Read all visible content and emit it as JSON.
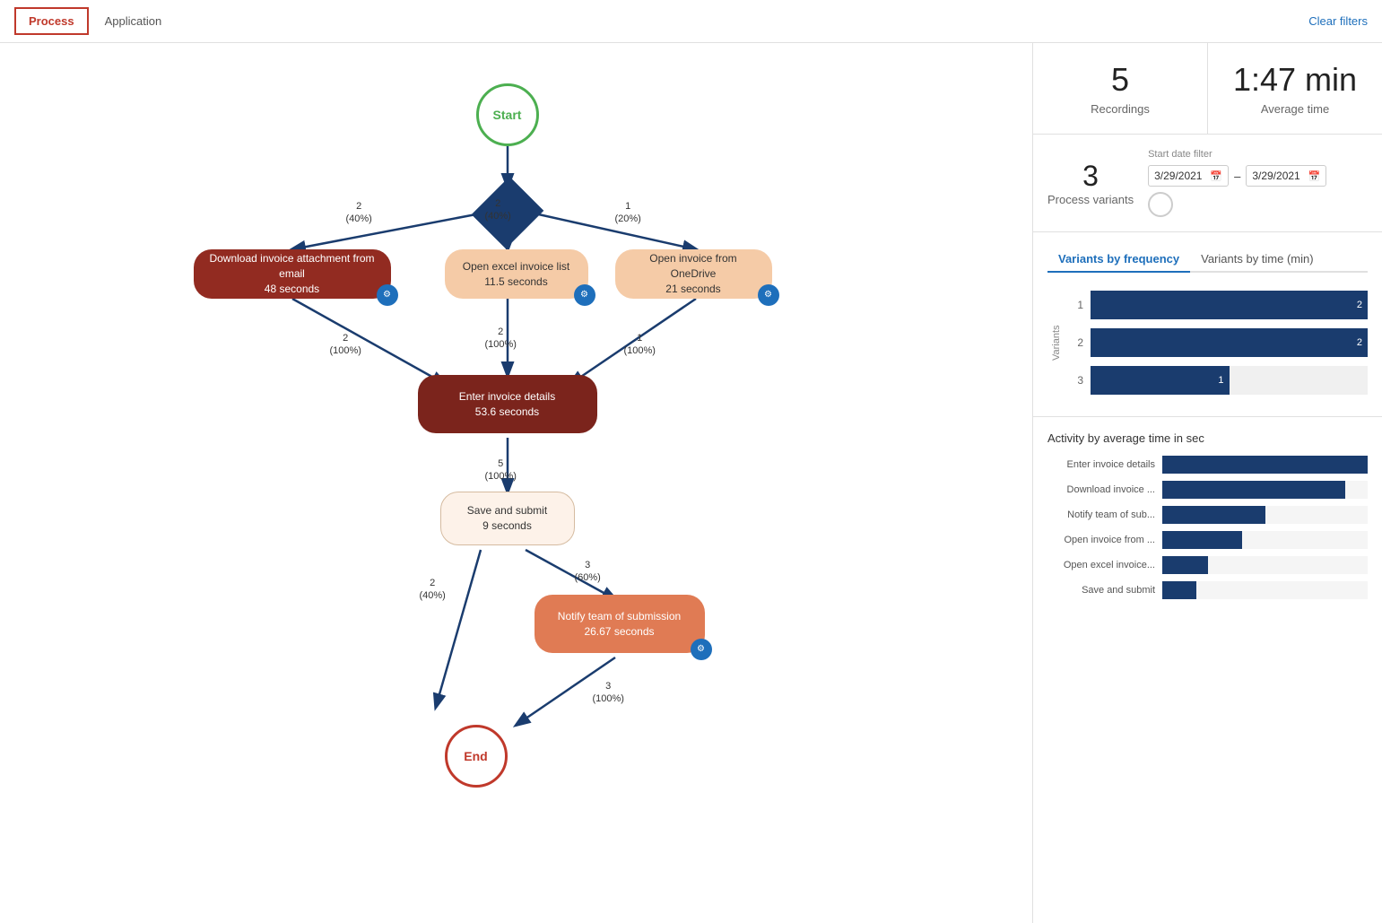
{
  "tabs": {
    "items": [
      "Process",
      "Application"
    ],
    "active": "Process"
  },
  "clear_filters": "Clear filters",
  "stats": {
    "recordings": {
      "value": "5",
      "label": "Recordings"
    },
    "average_time": {
      "value": "1:47 min",
      "label": "Average time"
    }
  },
  "process_variants": {
    "value": "3",
    "label": "Process variants"
  },
  "date_filter": {
    "label": "Start date filter",
    "from": "3/29/2021",
    "to": "3/29/2021"
  },
  "variants_chart": {
    "tab1": "Variants by frequency",
    "tab2": "Variants by time (min)",
    "active_tab": "tab1",
    "y_axis_label": "Variants",
    "bars": [
      {
        "label": "1",
        "value": 2,
        "max": 2
      },
      {
        "label": "2",
        "value": 2,
        "max": 2
      },
      {
        "label": "3",
        "value": 1,
        "max": 2
      }
    ]
  },
  "activity_chart": {
    "title": "Activity by average time in sec",
    "bars": [
      {
        "label": "Enter invoice details",
        "value": 54,
        "display": "54",
        "max": 54
      },
      {
        "label": "Download invoice ...",
        "value": 48,
        "display": "48",
        "max": 54
      },
      {
        "label": "Notify team of sub...",
        "value": 27,
        "display": "27",
        "max": 54
      },
      {
        "label": "Open invoice from ...",
        "value": 21,
        "display": "21",
        "max": 54
      },
      {
        "label": "Open excel invoice...",
        "value": 12,
        "display": "12",
        "max": 54
      },
      {
        "label": "Save and submit",
        "value": 9,
        "display": "9",
        "max": 54
      }
    ]
  },
  "flow": {
    "start_label": "Start",
    "end_label": "End",
    "nodes": [
      {
        "id": "start",
        "label": "Start",
        "type": "start"
      },
      {
        "id": "download",
        "label": "Download invoice attachment from email\n48 seconds",
        "type": "red"
      },
      {
        "id": "excel",
        "label": "Open excel invoice list\n11.5 seconds",
        "type": "light"
      },
      {
        "id": "onedrive",
        "label": "Open invoice from OneDrive\n21 seconds",
        "type": "light"
      },
      {
        "id": "enter",
        "label": "Enter invoice details\n53.6 seconds",
        "type": "darkred"
      },
      {
        "id": "save",
        "label": "Save and submit\n9 seconds",
        "type": "white"
      },
      {
        "id": "notify",
        "label": "Notify team of submission\n26.67 seconds",
        "type": "orange"
      },
      {
        "id": "end",
        "label": "End",
        "type": "end"
      }
    ],
    "edges": [
      {
        "from": "start",
        "to": "download",
        "label": "2\n(40%)"
      },
      {
        "from": "start",
        "to": "excel",
        "label": "2\n(40%)"
      },
      {
        "from": "start",
        "to": "onedrive",
        "label": "1\n(20%)"
      },
      {
        "from": "download",
        "to": "enter",
        "label": "2\n(100%)"
      },
      {
        "from": "excel",
        "to": "enter",
        "label": "2\n(100%)"
      },
      {
        "from": "onedrive",
        "to": "enter",
        "label": "1\n(100%)"
      },
      {
        "from": "enter",
        "to": "save",
        "label": "5\n(100%)"
      },
      {
        "from": "save",
        "to": "notify",
        "label": "3\n(60%)"
      },
      {
        "from": "save",
        "to": "end",
        "label": "2\n(40%)"
      },
      {
        "from": "notify",
        "to": "end",
        "label": "3\n(100%)"
      }
    ]
  }
}
